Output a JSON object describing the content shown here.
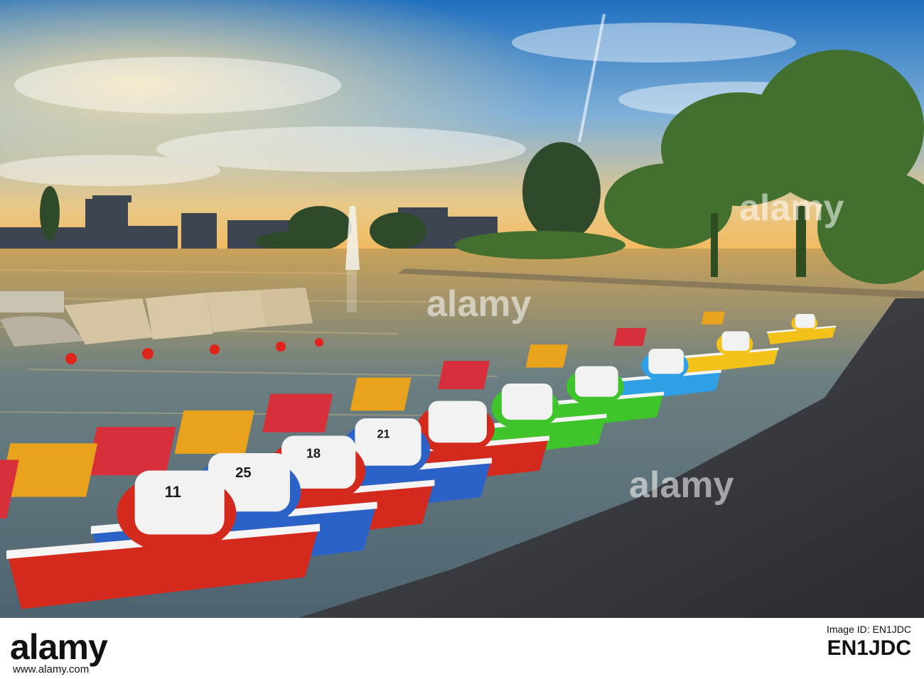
{
  "scene": {
    "colors": {
      "sky_top": "#2a78c8",
      "sky_horizon": "#f2c266",
      "water": "#7d8a7f",
      "pavement": "#3b3d44",
      "trees": "#3f6e2f"
    }
  },
  "boats": [
    {
      "number": "11",
      "color": "#d42a1e"
    },
    {
      "number": "25",
      "color": "#2a62c8"
    },
    {
      "number": "18",
      "color": "#d42a1e"
    },
    {
      "number": "21",
      "color": "#2a62c8"
    },
    {
      "number": "",
      "color": "#d42a1e"
    },
    {
      "number": "",
      "color": "#3fc42b"
    },
    {
      "number": "",
      "color": "#3fc42b"
    },
    {
      "number": "",
      "color": "#2ea1e6"
    },
    {
      "number": "",
      "color": "#f2c21a"
    },
    {
      "number": "",
      "color": "#f2c21a"
    }
  ],
  "watermark": {
    "text": "alamy"
  },
  "footer": {
    "logo": "alamy",
    "image_id_label": "Image ID: EN1JDC",
    "image_id": "EN1JDC",
    "url": "www.alamy.com"
  }
}
